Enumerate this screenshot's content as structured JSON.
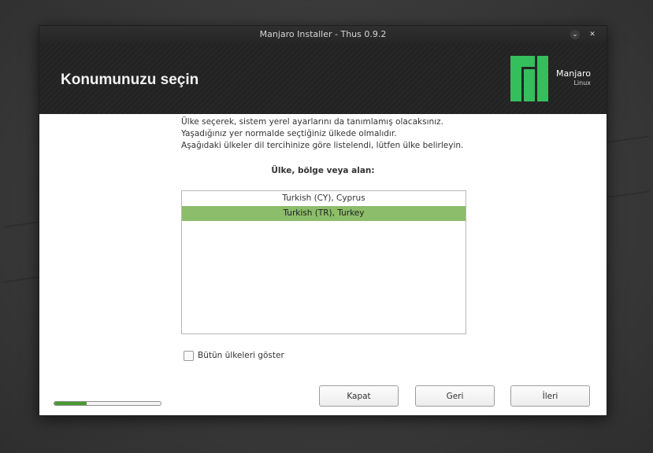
{
  "window": {
    "title": "Manjaro Installer - Thus 0.9.2",
    "minimize_glyph": "⌄",
    "close_glyph": "✕"
  },
  "header": {
    "title": "Konumunuzu seçin",
    "logo_name": "Manjaro",
    "logo_sub": "Linux",
    "logo_color": "#35bf5c"
  },
  "intro": {
    "line1": "Ülke seçerek, sistem yerel ayarlarını da tanımlamış olacaksınız.",
    "line2": "Yaşadığınız yer normalde seçtiğiniz ülkede olmalıdır.",
    "line3": "Aşağıdaki ülkeler dil tercihinize göre listelendi, lütfen ülke belirleyin."
  },
  "list": {
    "label": "Ülke, bölge veya alan:",
    "items": [
      "Turkish (CY), Cyprus",
      "Turkish (TR), Turkey"
    ],
    "selected_index": 1,
    "selected_color": "#8cbd6a"
  },
  "checkbox": {
    "label": "Bütün ülkeleri göster",
    "checked": false
  },
  "progress": {
    "fraction": 0.3
  },
  "buttons": {
    "close": "Kapat",
    "back": "Geri",
    "next": "İleri"
  }
}
